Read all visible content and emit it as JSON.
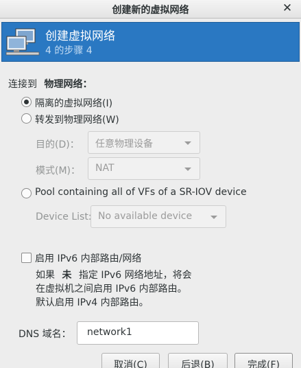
{
  "window": {
    "title": "创建新的虚拟网络",
    "close_glyph": "✕"
  },
  "header": {
    "title": "创建虚拟网络",
    "step": "4 的步骤 4"
  },
  "connect": {
    "label": "连接到",
    "value": "物理网络：",
    "option_isolated": "隔离的虚拟网络(I)",
    "option_forward": "转发到物理网络(W)",
    "dest_label": "目的(D)：",
    "dest_value": "任意物理设备",
    "mode_label": "模式(M)：",
    "mode_value": "NAT",
    "option_sriov": "Pool containing all of VFs of a SR-IOV device",
    "device_list_label": "Device List:",
    "device_list_value": "No available device"
  },
  "ipv6": {
    "checkbox_label": "启用 IPv6 内部路由/网络",
    "desc_line1_a": "如果",
    "desc_line1_b": "未",
    "desc_line1_c": "指定 IPv6 网络地址，将会",
    "desc_line2": "在虚拟机之间启用 IPv6 内部路由。",
    "desc_line3": "默认启用 IPv4 内部路由。"
  },
  "dns": {
    "label": "DNS 域名：",
    "value": "network1"
  },
  "buttons": {
    "cancel": "取消(C)",
    "back": "后退(B)",
    "finish": "完成(F)"
  },
  "colors": {
    "header_bg": "#2a78c2",
    "window_bg": "#ededed"
  }
}
